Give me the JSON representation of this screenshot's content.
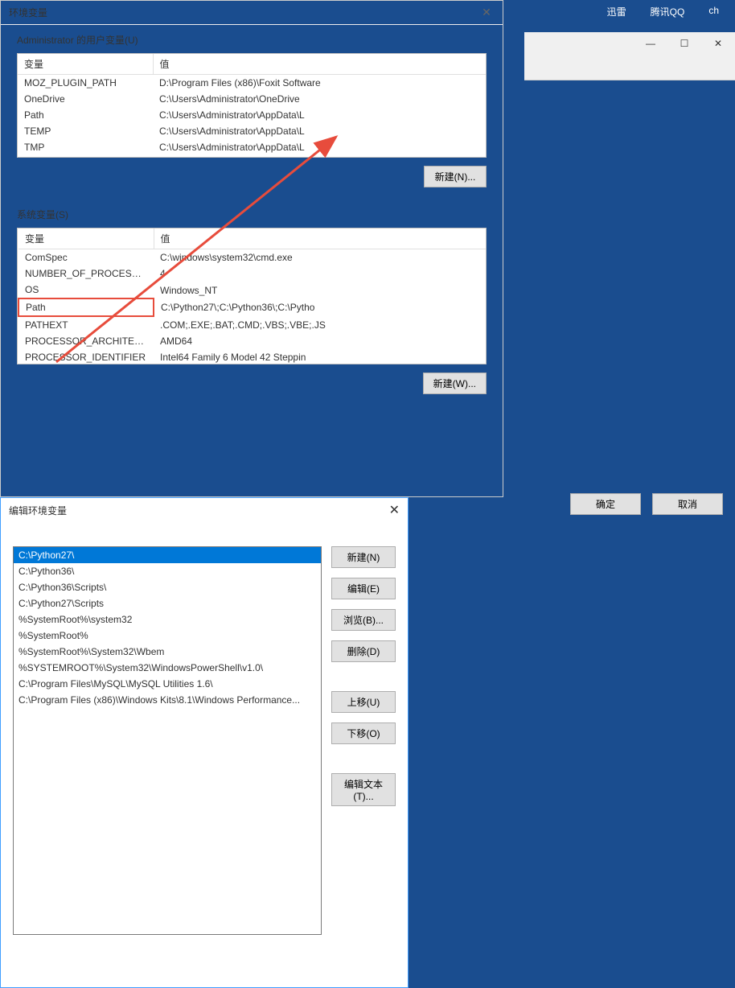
{
  "taskbar": {
    "items": [
      "迅雷",
      "腾讯QQ",
      "ch"
    ]
  },
  "env_window": {
    "title": "环境变量",
    "user_section_label": "Administrator 的用户变量(U)",
    "sys_section_label": "系统变量(S)",
    "headers": {
      "var": "变量",
      "val": "值"
    },
    "user_vars": [
      {
        "name": "MOZ_PLUGIN_PATH",
        "value": "D:\\Program Files (x86)\\Foxit Software"
      },
      {
        "name": "OneDrive",
        "value": "C:\\Users\\Administrator\\OneDrive"
      },
      {
        "name": "Path",
        "value": "C:\\Users\\Administrator\\AppData\\L"
      },
      {
        "name": "TEMP",
        "value": "C:\\Users\\Administrator\\AppData\\L"
      },
      {
        "name": "TMP",
        "value": "C:\\Users\\Administrator\\AppData\\L"
      }
    ],
    "sys_vars": [
      {
        "name": "ComSpec",
        "value": "C:\\windows\\system32\\cmd.exe"
      },
      {
        "name": "NUMBER_OF_PROCESSORS",
        "value": "4"
      },
      {
        "name": "OS",
        "value": "Windows_NT"
      },
      {
        "name": "Path",
        "value": "C:\\Python27\\;C:\\Python36\\;C:\\Pytho"
      },
      {
        "name": "PATHEXT",
        "value": ".COM;.EXE;.BAT;.CMD;.VBS;.VBE;.JS"
      },
      {
        "name": "PROCESSOR_ARCHITECT...",
        "value": "AMD64"
      },
      {
        "name": "PROCESSOR_IDENTIFIER",
        "value": "Intel64 Family 6 Model 42 Steppin"
      }
    ],
    "buttons": {
      "new_n": "新建(N)...",
      "new_w": "新建(W)..."
    }
  },
  "edit_window": {
    "title": "编辑环境变量",
    "items": [
      "C:\\Python27\\",
      "C:\\Python36\\",
      "C:\\Python36\\Scripts\\",
      "C:\\Python27\\Scripts",
      "%SystemRoot%\\system32",
      "%SystemRoot%",
      "%SystemRoot%\\System32\\Wbem",
      "%SYSTEMROOT%\\System32\\WindowsPowerShell\\v1.0\\",
      "C:\\Program Files\\MySQL\\MySQL Utilities 1.6\\",
      "C:\\Program Files (x86)\\Windows Kits\\8.1\\Windows Performance..."
    ],
    "buttons": {
      "new": "新建(N)",
      "edit": "编辑(E)",
      "browse": "浏览(B)...",
      "delete": "删除(D)",
      "moveup": "上移(U)",
      "movedown": "下移(O)",
      "edittext": "编辑文本(T)...",
      "ok": "确定",
      "cancel": "取消"
    }
  }
}
